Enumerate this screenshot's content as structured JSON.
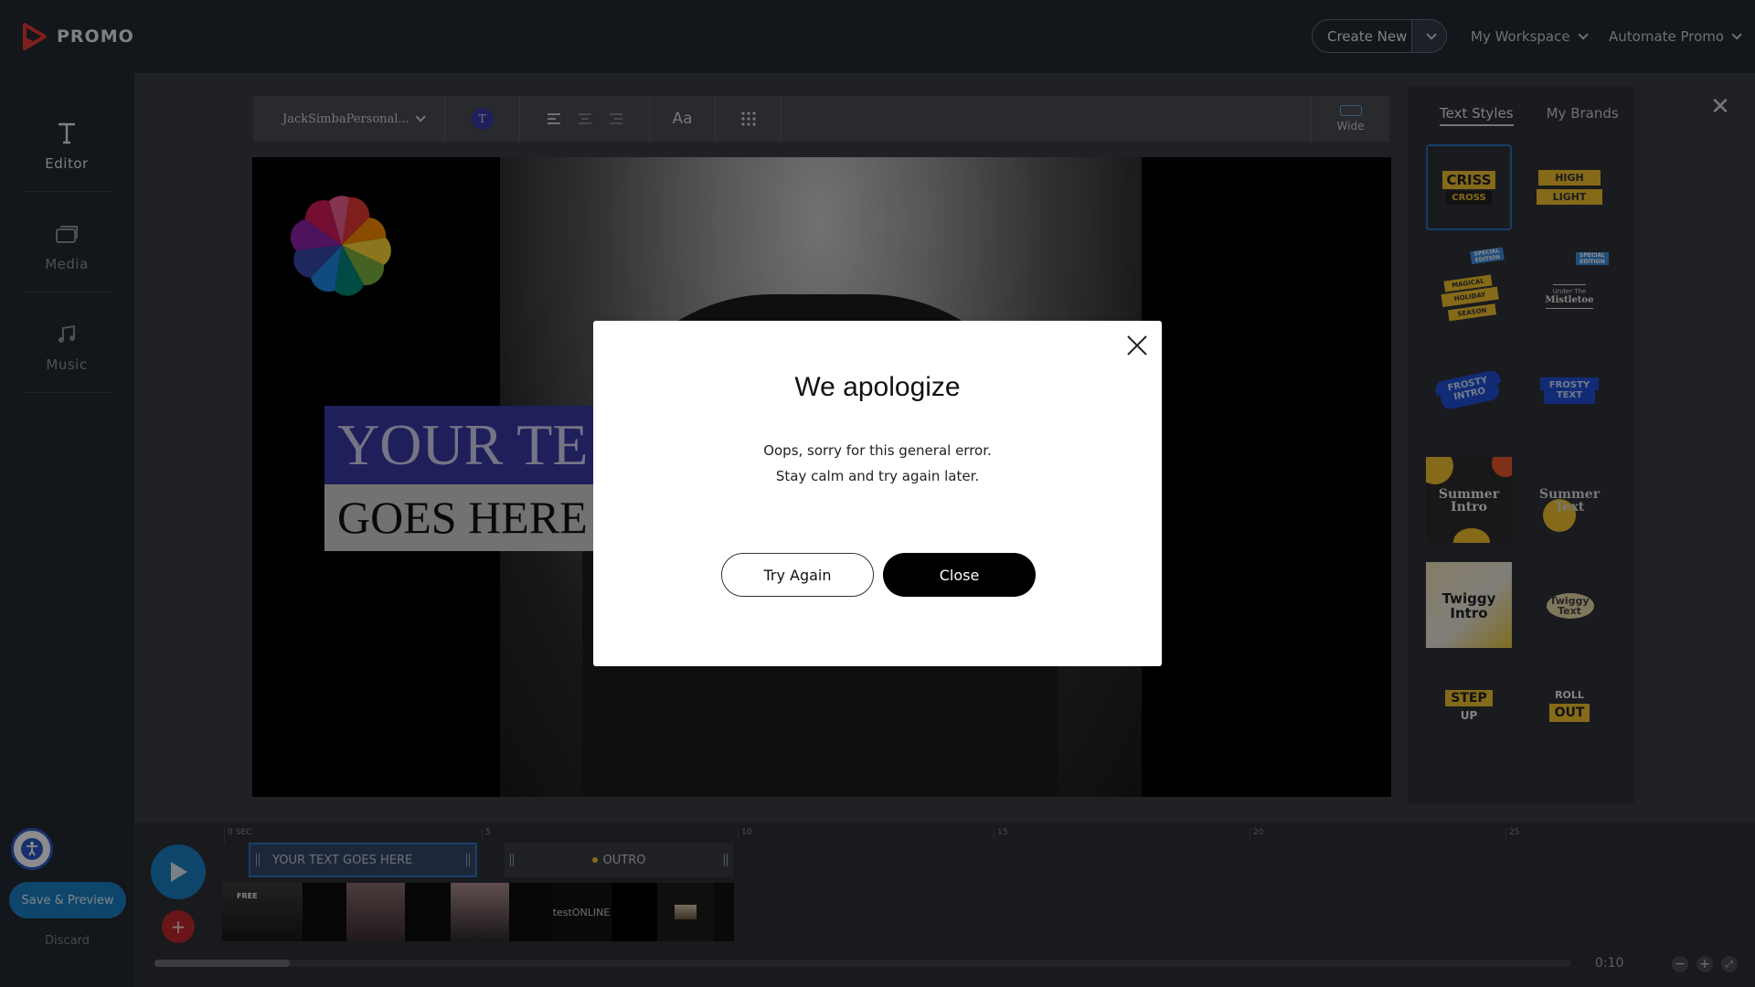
{
  "brand": {
    "name": "PROMO",
    "color": "#e53935"
  },
  "topnav": {
    "create_new": "Create New",
    "my_workspace": "My Workspace",
    "automate": "Automate Promo"
  },
  "sidebar": {
    "items": [
      {
        "label": "Editor",
        "icon": "text-t-icon"
      },
      {
        "label": "Media",
        "icon": "media-icon"
      },
      {
        "label": "Music",
        "icon": "music-note-icon"
      }
    ],
    "save_preview": "Save & Preview",
    "discard": "Discard"
  },
  "toolbar": {
    "font_name": "JackSimbaPersonal...",
    "color_badge": "T",
    "text_case": "Aa",
    "ratio_label": "Wide"
  },
  "canvas": {
    "line1": "YOUR TE",
    "line2": "GOES HERE"
  },
  "right_panel": {
    "tabs": [
      "Text Styles",
      "My Brands"
    ],
    "styles": [
      {
        "label_a": "CRISS",
        "label_b": "CROSS"
      },
      {
        "label_a": "HIGH",
        "label_b": "LIGHT"
      },
      {
        "label_a": "MAGICAL",
        "label_b": "HOLIDAY",
        "label_c": "SEASON",
        "badge": "SPECIAL EDITION"
      },
      {
        "label_a": "Under The",
        "label_b": "Mistletoe",
        "badge": "SPECIAL EDITION"
      },
      {
        "label_a": "FROSTY",
        "label_b": "INTRO"
      },
      {
        "label_a": "FROSTY",
        "label_b": "TEXT"
      },
      {
        "label_a": "Summer",
        "label_b": "Intro"
      },
      {
        "label_a": "Summer",
        "label_b": "Text"
      },
      {
        "label_a": "Twiggy",
        "label_b": "Intro"
      },
      {
        "label_a": "Twiggy",
        "label_b": "Text"
      },
      {
        "label_a": "STEP",
        "label_b": "UP"
      },
      {
        "label_a": "ROLL",
        "label_b": "OUT"
      }
    ]
  },
  "timeline": {
    "ticks": [
      "0 SEC",
      "5",
      "10",
      "15",
      "20",
      "25"
    ],
    "text_clip": "YOUR TEXT GOES HERE",
    "outro_clip": "OUTRO",
    "free_badge": "FREE",
    "clip_label": "testONLINE",
    "time": "0:10"
  },
  "modal": {
    "title": "We apologize",
    "line1": "Oops, sorry for this general error.",
    "line2": "Stay calm and try again later.",
    "try_again": "Try Again",
    "close": "Close"
  }
}
